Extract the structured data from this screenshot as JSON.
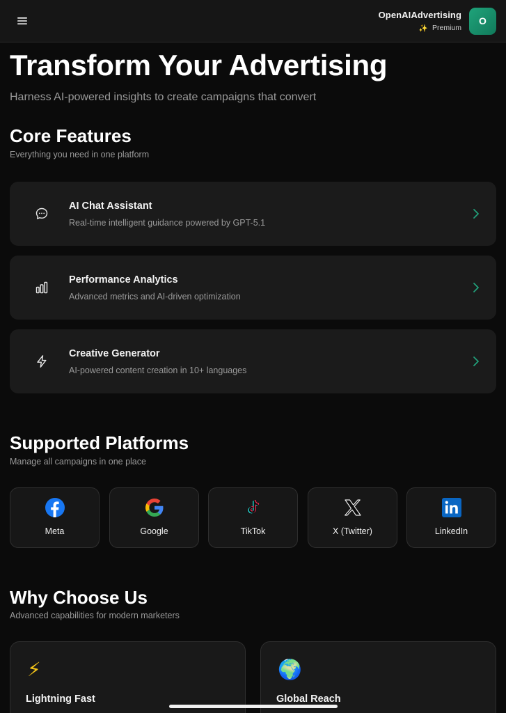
{
  "header": {
    "brand_name": "OpenAIAdvertising",
    "tier_icon": "sparkles-icon",
    "tier_icon_glyph": "✨",
    "tier_label": "Premium",
    "avatar_initial": "O"
  },
  "hero": {
    "title": "Transform Your Advertising",
    "subtitle": "Harness AI-powered insights to create campaigns that convert"
  },
  "core_features": {
    "title": "Core Features",
    "subtitle": "Everything you need in one platform",
    "items": [
      {
        "icon": "chat-bubble-icon",
        "title": "AI Chat Assistant",
        "description": "Real-time intelligent guidance powered by GPT-5.1"
      },
      {
        "icon": "bar-chart-icon",
        "title": "Performance Analytics",
        "description": "Advanced metrics and AI-driven optimization"
      },
      {
        "icon": "lightning-icon",
        "title": "Creative Generator",
        "description": "AI-powered content creation in 10+ languages"
      }
    ]
  },
  "platforms": {
    "title": "Supported Platforms",
    "subtitle": "Manage all campaigns in one place",
    "items": [
      {
        "icon": "meta-facebook-icon",
        "label": "Meta"
      },
      {
        "icon": "google-icon",
        "label": "Google"
      },
      {
        "icon": "tiktok-icon",
        "label": "TikTok"
      },
      {
        "icon": "x-twitter-icon",
        "label": "X (Twitter)"
      },
      {
        "icon": "linkedin-icon",
        "label": "LinkedIn"
      }
    ]
  },
  "why": {
    "title": "Why Choose Us",
    "subtitle": "Advanced capabilities for modern marketers",
    "items": [
      {
        "icon": "lightning-emoji-icon",
        "glyph": "⚡",
        "title": "Lightning Fast"
      },
      {
        "icon": "globe-emoji-icon",
        "glyph": "🌍",
        "title": "Global Reach"
      }
    ]
  },
  "colors": {
    "background": "#0b0b0b",
    "card": "#1b1b1b",
    "accent": "#1fa37a",
    "chevron": "#22a07a"
  }
}
